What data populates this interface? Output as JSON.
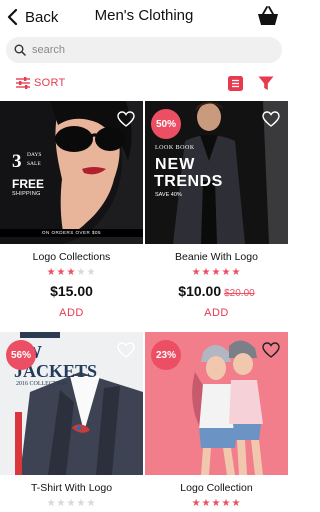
{
  "header": {
    "back_label": "Back",
    "title": "Men's Clothing"
  },
  "search": {
    "placeholder": "search"
  },
  "toolbar": {
    "sort_label": "SORT"
  },
  "products": [
    {
      "name": "Logo Collections",
      "rating": 3,
      "price": "$15.00",
      "add_label": "ADD",
      "image": {
        "days": "3",
        "days_word": "DAYS",
        "sale_word": "SALE",
        "free": "FREE",
        "shipping": "SHIPPING",
        "footer": "ON ORDERS OVER $05"
      }
    },
    {
      "name": "Beanie With Logo",
      "rating": 5,
      "badge": "50%",
      "price": "$10.00",
      "old_price": "$20.00",
      "add_label": "ADD",
      "image": {
        "lookbook": "LOOK BOOK",
        "new": "NEW",
        "trends": "TRENDS",
        "save": "SAVE 40%"
      }
    },
    {
      "name": "T-Shirt With Logo",
      "rating": 0,
      "badge": "56%",
      "image": {
        "line1": "W",
        "line2": "JACKETS",
        "line3": "2016 COLLECTION"
      }
    },
    {
      "name": "Logo Collection",
      "rating": 5,
      "badge": "23%"
    }
  ],
  "colors": {
    "accent": "#ec4f63",
    "card_dark": "#131315",
    "pink_bg": "#f27e8c"
  }
}
